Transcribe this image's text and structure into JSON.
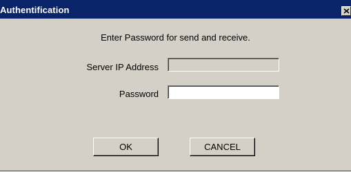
{
  "window": {
    "title": "Authentification",
    "close_icon": "close-icon"
  },
  "prompt": "Enter Password for send and receive.",
  "fields": {
    "server_label": "Server IP Address",
    "server_value": "",
    "password_label": "Password",
    "password_value": ""
  },
  "buttons": {
    "ok_label": "OK",
    "cancel_label": "CANCEL"
  },
  "colors": {
    "titlebar": "#0a246a",
    "face": "#d4d0c8",
    "title_text": "#ffffff"
  }
}
